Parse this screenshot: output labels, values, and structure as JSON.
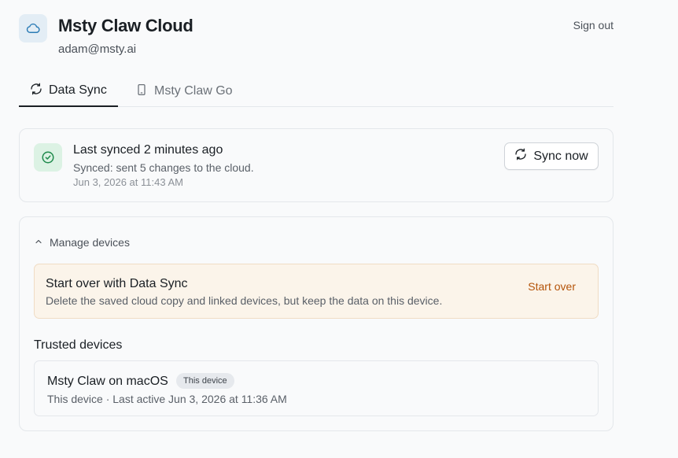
{
  "header": {
    "icon": "cloud-icon",
    "title": "Msty Claw Cloud",
    "email": "adam@msty.ai",
    "sign_out": "Sign out"
  },
  "tabs": [
    {
      "label": "Data Sync",
      "icon": "sync-icon",
      "active": true
    },
    {
      "label": "Msty Claw Go",
      "icon": "phone-icon",
      "active": false
    }
  ],
  "sync_status": {
    "icon": "check-circle-icon",
    "title": "Last synced 2 minutes ago",
    "subtitle": "Synced: sent 5 changes to the cloud.",
    "timestamp": "Jun 3, 2026 at 11:43 AM",
    "button_label": "Sync now"
  },
  "manage": {
    "toggle_label": "Manage devices",
    "expanded": true,
    "start_over": {
      "title": "Start over with Data Sync",
      "description": "Delete the saved cloud copy and linked devices, but keep the data on this device.",
      "button_label": "Start over"
    },
    "trusted_heading": "Trusted devices",
    "devices": [
      {
        "name": "Msty Claw on macOS",
        "badge": "This device",
        "meta": "This device · Last active Jun 3, 2026 at 11:36 AM"
      }
    ]
  },
  "colors": {
    "accent_text": "#1a1f24",
    "success": "#1f8a4c",
    "cloud_icon": "#2a7bb5",
    "warning_action": "#b45309",
    "warning_bg": "#fbf4ea"
  }
}
